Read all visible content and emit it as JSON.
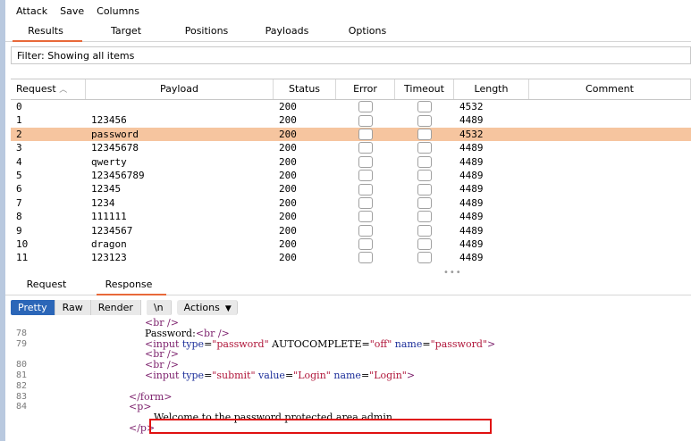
{
  "menu": [
    "Attack",
    "Save",
    "Columns"
  ],
  "tabs": [
    "Results",
    "Target",
    "Positions",
    "Payloads",
    "Options"
  ],
  "active_tab": "Results",
  "filter_text": "Filter: Showing all items",
  "table": {
    "columns": [
      "Request",
      "Payload",
      "Status",
      "Error",
      "Timeout",
      "Length",
      "Comment"
    ],
    "sort_indicator": "︿",
    "rows": [
      {
        "request": "0",
        "payload": "",
        "status": "200",
        "length": "4532",
        "selected": false
      },
      {
        "request": "1",
        "payload": "123456",
        "status": "200",
        "length": "4489",
        "selected": false
      },
      {
        "request": "2",
        "payload": "password",
        "status": "200",
        "length": "4532",
        "selected": true
      },
      {
        "request": "3",
        "payload": "12345678",
        "status": "200",
        "length": "4489",
        "selected": false
      },
      {
        "request": "4",
        "payload": "qwerty",
        "status": "200",
        "length": "4489",
        "selected": false
      },
      {
        "request": "5",
        "payload": "123456789",
        "status": "200",
        "length": "4489",
        "selected": false
      },
      {
        "request": "6",
        "payload": "12345",
        "status": "200",
        "length": "4489",
        "selected": false
      },
      {
        "request": "7",
        "payload": "1234",
        "status": "200",
        "length": "4489",
        "selected": false
      },
      {
        "request": "8",
        "payload": "111111",
        "status": "200",
        "length": "4489",
        "selected": false
      },
      {
        "request": "9",
        "payload": "1234567",
        "status": "200",
        "length": "4489",
        "selected": false
      },
      {
        "request": "10",
        "payload": "dragon",
        "status": "200",
        "length": "4489",
        "selected": false
      },
      {
        "request": "11",
        "payload": "123123",
        "status": "200",
        "length": "4489",
        "selected": false
      }
    ]
  },
  "splitter_dots": "•••",
  "response_tabs": [
    "Request",
    "Response"
  ],
  "active_response_tab": "Response",
  "view_buttons": [
    "Pretty",
    "Raw",
    "Render",
    "\\n",
    "Actions"
  ],
  "active_view": "Pretty",
  "code_lines": [
    {
      "num": "",
      "indent": 150,
      "parts": [
        {
          "t": "tag",
          "v": "<br />"
        }
      ]
    },
    {
      "num": "78",
      "indent": 150,
      "parts": [
        {
          "t": "plain",
          "v": "Password:"
        },
        {
          "t": "tag",
          "v": "<br />"
        }
      ]
    },
    {
      "num": "79",
      "indent": 150,
      "parts": [
        {
          "t": "tag",
          "v": "<input "
        },
        {
          "t": "attr",
          "v": "type"
        },
        {
          "t": "plain",
          "v": "="
        },
        {
          "t": "val",
          "v": "\"password\""
        },
        {
          "t": "plain",
          "v": " AUTOCOMPLETE="
        },
        {
          "t": "val",
          "v": "\"off\""
        },
        {
          "t": "attr",
          "v": " name"
        },
        {
          "t": "plain",
          "v": "="
        },
        {
          "t": "val",
          "v": "\"password\""
        },
        {
          "t": "tag",
          "v": ">"
        }
      ]
    },
    {
      "num": "",
      "indent": 150,
      "parts": [
        {
          "t": "tag",
          "v": "<br />"
        }
      ]
    },
    {
      "num": "80",
      "indent": 150,
      "parts": [
        {
          "t": "tag",
          "v": "<br />"
        }
      ]
    },
    {
      "num": "81",
      "indent": 150,
      "parts": [
        {
          "t": "tag",
          "v": "<input "
        },
        {
          "t": "attr",
          "v": "type"
        },
        {
          "t": "plain",
          "v": "="
        },
        {
          "t": "val",
          "v": "\"submit\""
        },
        {
          "t": "attr",
          "v": " value"
        },
        {
          "t": "plain",
          "v": "="
        },
        {
          "t": "val",
          "v": "\"Login\""
        },
        {
          "t": "attr",
          "v": " name"
        },
        {
          "t": "plain",
          "v": "="
        },
        {
          "t": "val",
          "v": "\"Login\""
        },
        {
          "t": "tag",
          "v": ">"
        }
      ]
    },
    {
      "num": "82",
      "indent": 150,
      "parts": []
    },
    {
      "num": "83",
      "indent": 132,
      "parts": [
        {
          "t": "tag",
          "v": "</form>"
        }
      ]
    },
    {
      "num": "84",
      "indent": 132,
      "parts": [
        {
          "t": "tag",
          "v": "<p>"
        }
      ]
    },
    {
      "num": "",
      "indent": 160,
      "parts": [
        {
          "t": "plain",
          "v": "Welcome to the password protected area admin"
        }
      ]
    },
    {
      "num": "",
      "indent": 132,
      "parts": [
        {
          "t": "tag",
          "v": "</p>"
        }
      ]
    }
  ],
  "highlight_line_index": 9,
  "colors": {
    "accent": "#e8693a",
    "selected_row": "#f6c59f",
    "active_view": "#2b66b8",
    "highlight_box": "#e01010"
  }
}
